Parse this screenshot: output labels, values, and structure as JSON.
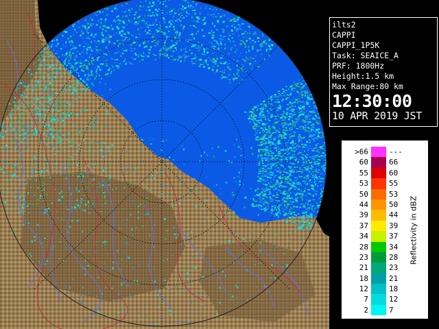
{
  "info": {
    "site": "ilts2",
    "product": "CAPPI",
    "product_id": "CAPPI_1P5K",
    "task": "Task: SEAICE_A",
    "prf": "PRF: 1800Hz",
    "height": "Height:1.5 km",
    "max_range": "Max Range:80 km",
    "time": "12:30:00",
    "date": "10 APR 2019 JST"
  },
  "legend": {
    "title": "Reflectivity in dBZ",
    "rows": [
      {
        "lo": ">66",
        "hi": "---",
        "color": "#ff33ff"
      },
      {
        "lo": "60",
        "hi": "66",
        "color": "#a8004f"
      },
      {
        "lo": "55",
        "hi": "60",
        "color": "#e00000"
      },
      {
        "lo": "53",
        "hi": "55",
        "color": "#ff3300"
      },
      {
        "lo": "50",
        "hi": "53",
        "color": "#ff6a00"
      },
      {
        "lo": "44",
        "hi": "50",
        "color": "#ff9500"
      },
      {
        "lo": "39",
        "hi": "44",
        "color": "#ffbb00"
      },
      {
        "lo": "37",
        "hi": "39",
        "color": "#ffea00"
      },
      {
        "lo": "34",
        "hi": "37",
        "color": "#c8f000"
      },
      {
        "lo": "28",
        "hi": "34",
        "color": "#00c800"
      },
      {
        "lo": "23",
        "hi": "28",
        "color": "#009a3a"
      },
      {
        "lo": "21",
        "hi": "23",
        "color": "#00a87a"
      },
      {
        "lo": "18",
        "hi": "21",
        "color": "#00a0a8"
      },
      {
        "lo": "12",
        "hi": "18",
        "color": "#00c0c8"
      },
      {
        "lo": "7",
        "hi": "12",
        "color": "#00dde0"
      },
      {
        "lo": "2",
        "hi": "7",
        "color": "#00f5f5"
      }
    ]
  },
  "colors": {
    "sea": "#0a5ae6",
    "land": "#9a7e52",
    "echo_light": "#3cc8c0",
    "echo_cyan": "#00f0f0",
    "echo_green": "#2bbf6a",
    "river": "#6070e8",
    "border": "#c03040"
  }
}
